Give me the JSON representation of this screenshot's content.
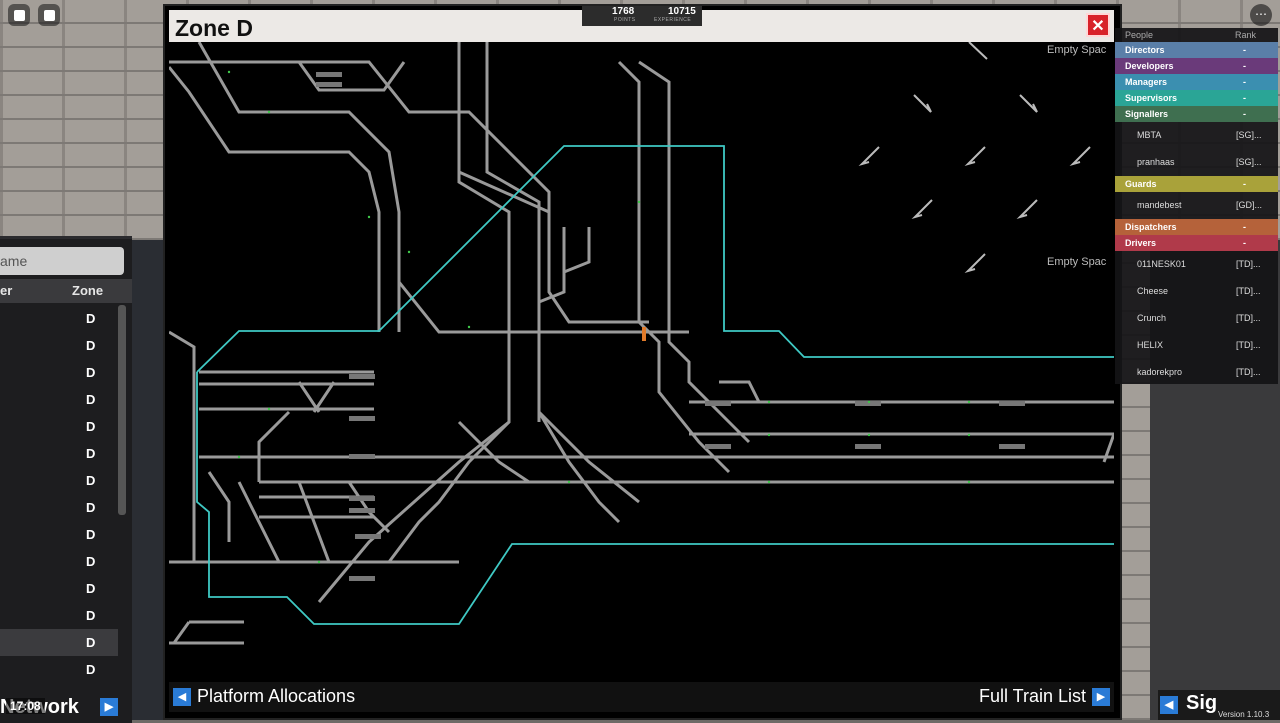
{
  "window": {
    "title": "Zone D",
    "close_label": "✕"
  },
  "stats": {
    "points_value": "1768",
    "points_label": "POINTS",
    "exp_value": "10715",
    "exp_label": "EXPERIENCE"
  },
  "map": {
    "empty_space_labels": [
      "Empty Spac",
      "Empty Spac"
    ],
    "platform_labels": [
      "3",
      "4",
      "1",
      "2",
      "3",
      "4",
      "5B",
      "6A",
      "6",
      "1",
      "1",
      "1",
      "2",
      "2",
      "2"
    ],
    "train_headcode": "2V10"
  },
  "footer": {
    "left_button": "Platform Allocations",
    "right_button": "Full Train List"
  },
  "left_panel": {
    "search_placeholder": "ame",
    "col1": "er",
    "col2": "Zone",
    "rows": [
      "D",
      "D",
      "D",
      "D",
      "D",
      "D",
      "D",
      "D",
      "D",
      "D",
      "D",
      "D",
      "D",
      "D"
    ],
    "network_label": "Network",
    "time": "17:08"
  },
  "people": {
    "header_people": "People",
    "header_rank": "Rank",
    "teams": [
      {
        "name": "Directors",
        "count": "-",
        "color": "#5a7fa8",
        "players": []
      },
      {
        "name": "Developers",
        "count": "-",
        "color": "#6a3a7a",
        "players": []
      },
      {
        "name": "Managers",
        "count": "-",
        "color": "#3b8fb0",
        "players": []
      },
      {
        "name": "Supervisors",
        "count": "-",
        "color": "#2aa596",
        "players": []
      },
      {
        "name": "Signallers",
        "count": "-",
        "color": "#3f6f50",
        "players": [
          {
            "name": "MBTA",
            "rank": "[SG]..."
          },
          {
            "name": "pranhaas",
            "rank": "[SG]..."
          }
        ]
      },
      {
        "name": "Guards",
        "count": "-",
        "color": "#a9a23a",
        "players": [
          {
            "name": "mandebest",
            "rank": "[GD]..."
          }
        ]
      },
      {
        "name": "Dispatchers",
        "count": "-",
        "color": "#b5623a",
        "players": []
      },
      {
        "name": "Drivers",
        "count": "-",
        "color": "#b03a4a",
        "players": [
          {
            "name": "011NESK01",
            "rank": "[TD]..."
          },
          {
            "name": "Cheese",
            "rank": "[TD]..."
          },
          {
            "name": "Crunch",
            "rank": "[TD]..."
          },
          {
            "name": "HELIX",
            "rank": "[TD]..."
          },
          {
            "name": "kadorekpro",
            "rank": "[TD]..."
          }
        ]
      }
    ]
  },
  "right_bottom": {
    "label": "Sig",
    "version": "Version 1.10.3"
  }
}
